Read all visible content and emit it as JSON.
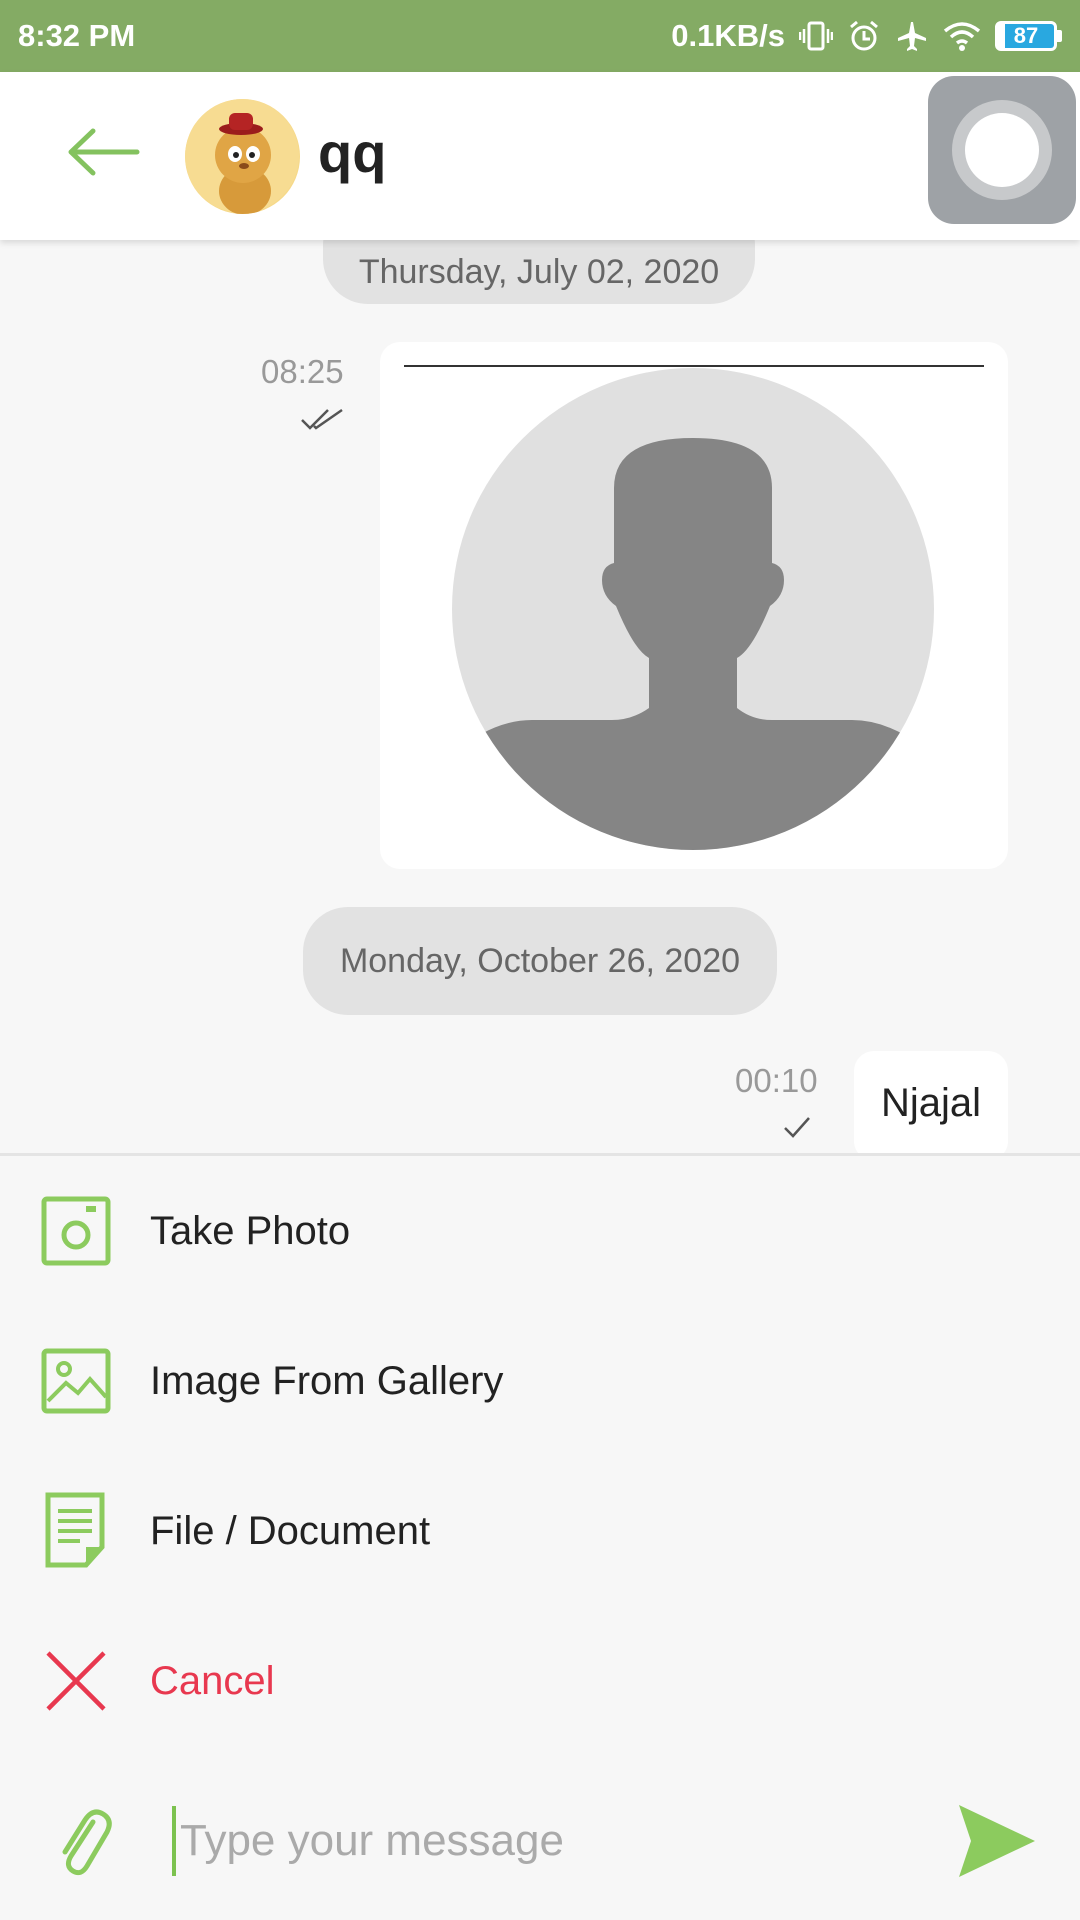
{
  "status_bar": {
    "time": "8:32 PM",
    "network_speed": "0.1KB/s",
    "battery_level": "87",
    "icons": [
      "vibrate-icon",
      "alarm-icon",
      "airplane-icon",
      "wifi-icon",
      "battery-icon"
    ]
  },
  "header": {
    "contact_name": "qq",
    "back_icon": "arrow-left-icon",
    "accent_color": "#84ab64"
  },
  "chat": {
    "messages": [
      {
        "date_separator": "Thursday, July 02, 2020",
        "time": "08:25",
        "type": "image",
        "status": "read"
      },
      {
        "date_separator": "Monday, October 26, 2020",
        "time": "00:10",
        "type": "text",
        "text": "Njajal",
        "status": "sent"
      }
    ]
  },
  "attachment_menu": {
    "items": [
      {
        "label": "Take Photo",
        "icon": "camera-icon"
      },
      {
        "label": "Image From Gallery",
        "icon": "gallery-icon"
      },
      {
        "label": "File / Document",
        "icon": "document-icon"
      },
      {
        "label": "Cancel",
        "icon": "close-icon"
      }
    ],
    "icon_color": "#8ccb5e",
    "cancel_color": "#e8384f"
  },
  "composer": {
    "placeholder": "Type your message",
    "value": "",
    "attach_icon": "paperclip-icon",
    "send_icon": "send-icon"
  }
}
